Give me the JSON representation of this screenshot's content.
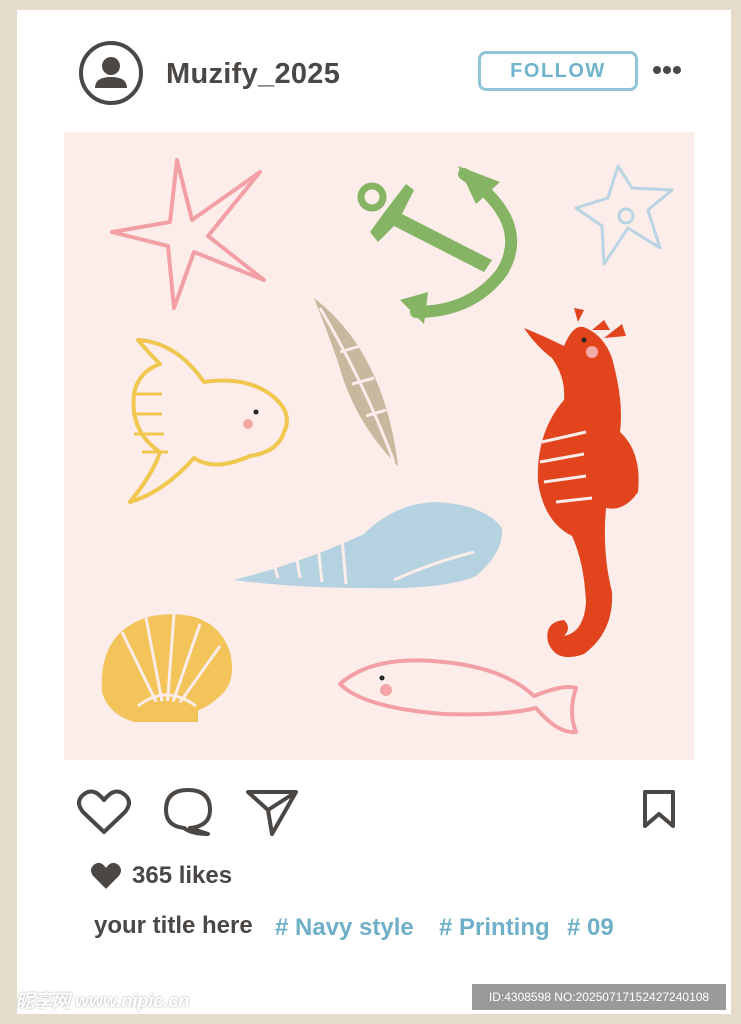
{
  "post": {
    "username": "Muzify_2025",
    "follow_label": "FOLLOW",
    "likes": "365 likes",
    "caption": "your title here",
    "tags": [
      "# Navy style",
      "# Printing",
      "# 09"
    ]
  },
  "watermark": {
    "left": "昵享网 www.nipic.cn",
    "right": "ID:4308598 NO:20250717152427240108"
  },
  "icons": {
    "avatar": "user-avatar-icon",
    "more": "more-dots-icon",
    "like": "heart-icon",
    "comment": "comment-bubble-icon",
    "share": "paper-plane-icon",
    "save": "bookmark-icon",
    "likes_heart": "filled-heart-icon"
  },
  "colors": {
    "text": "#4b4744",
    "accent": "#6fb4cb",
    "photo_bg": "#fcecea",
    "frame": "#e6dccb"
  }
}
